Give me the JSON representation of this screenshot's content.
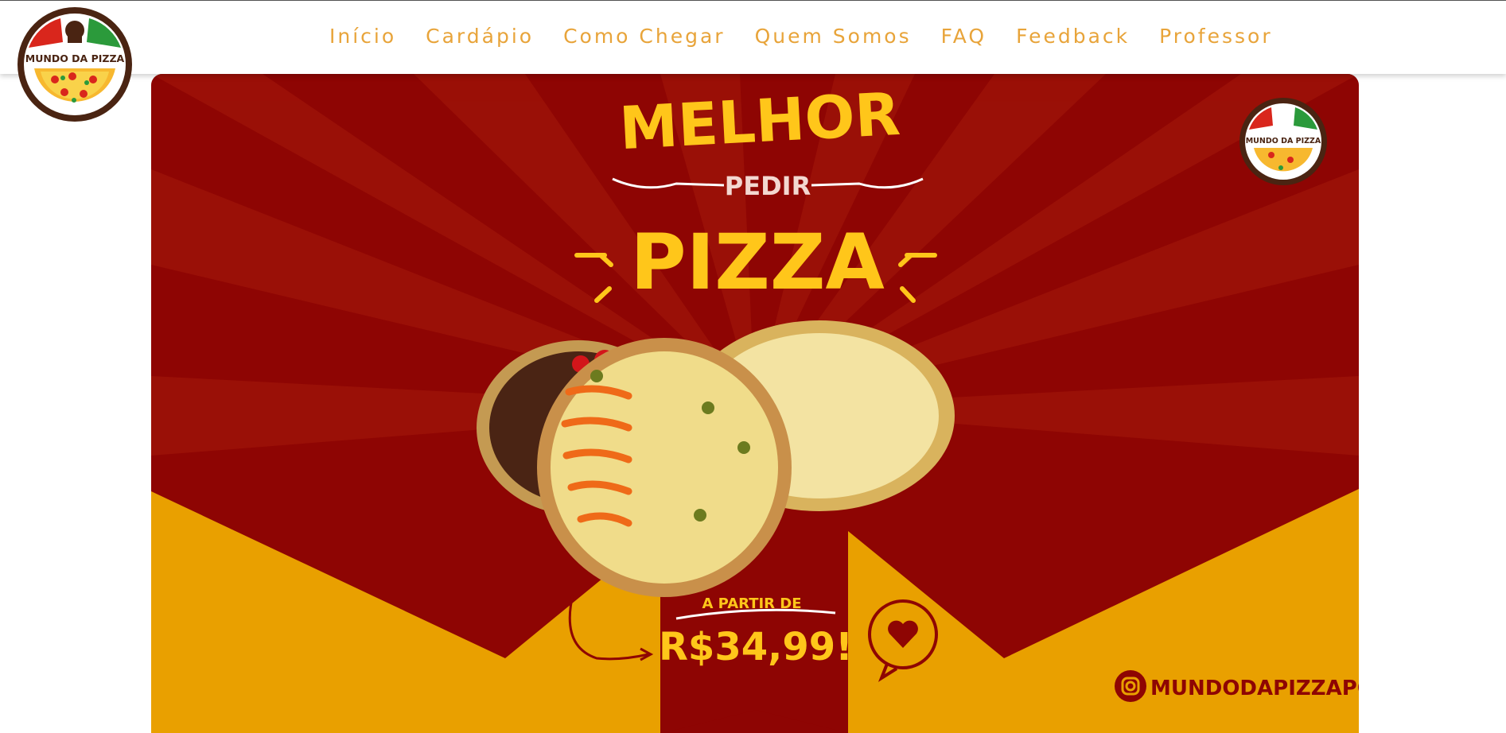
{
  "navbar": {
    "links": [
      {
        "label": "Início"
      },
      {
        "label": "Cardápio"
      },
      {
        "label": "Como Chegar"
      },
      {
        "label": "Quem Somos"
      },
      {
        "label": "FAQ"
      },
      {
        "label": "Feedback"
      },
      {
        "label": "Professor"
      }
    ],
    "link_color": "#e8a43a"
  },
  "logo": {
    "text": "MUNDO DA PIZZA"
  },
  "banner": {
    "headline_top": "MELHOR",
    "headline_mid": "PEDIR",
    "headline_main": "PIZZA",
    "price_prefix": "A PARTIR DE",
    "price": "R$34,99!",
    "instagram_handle": "MUNDODAPIZZAPG",
    "colors": {
      "red": "#8e0503",
      "yellow": "#e9a000",
      "text_yellow": "#ffc61a"
    }
  }
}
